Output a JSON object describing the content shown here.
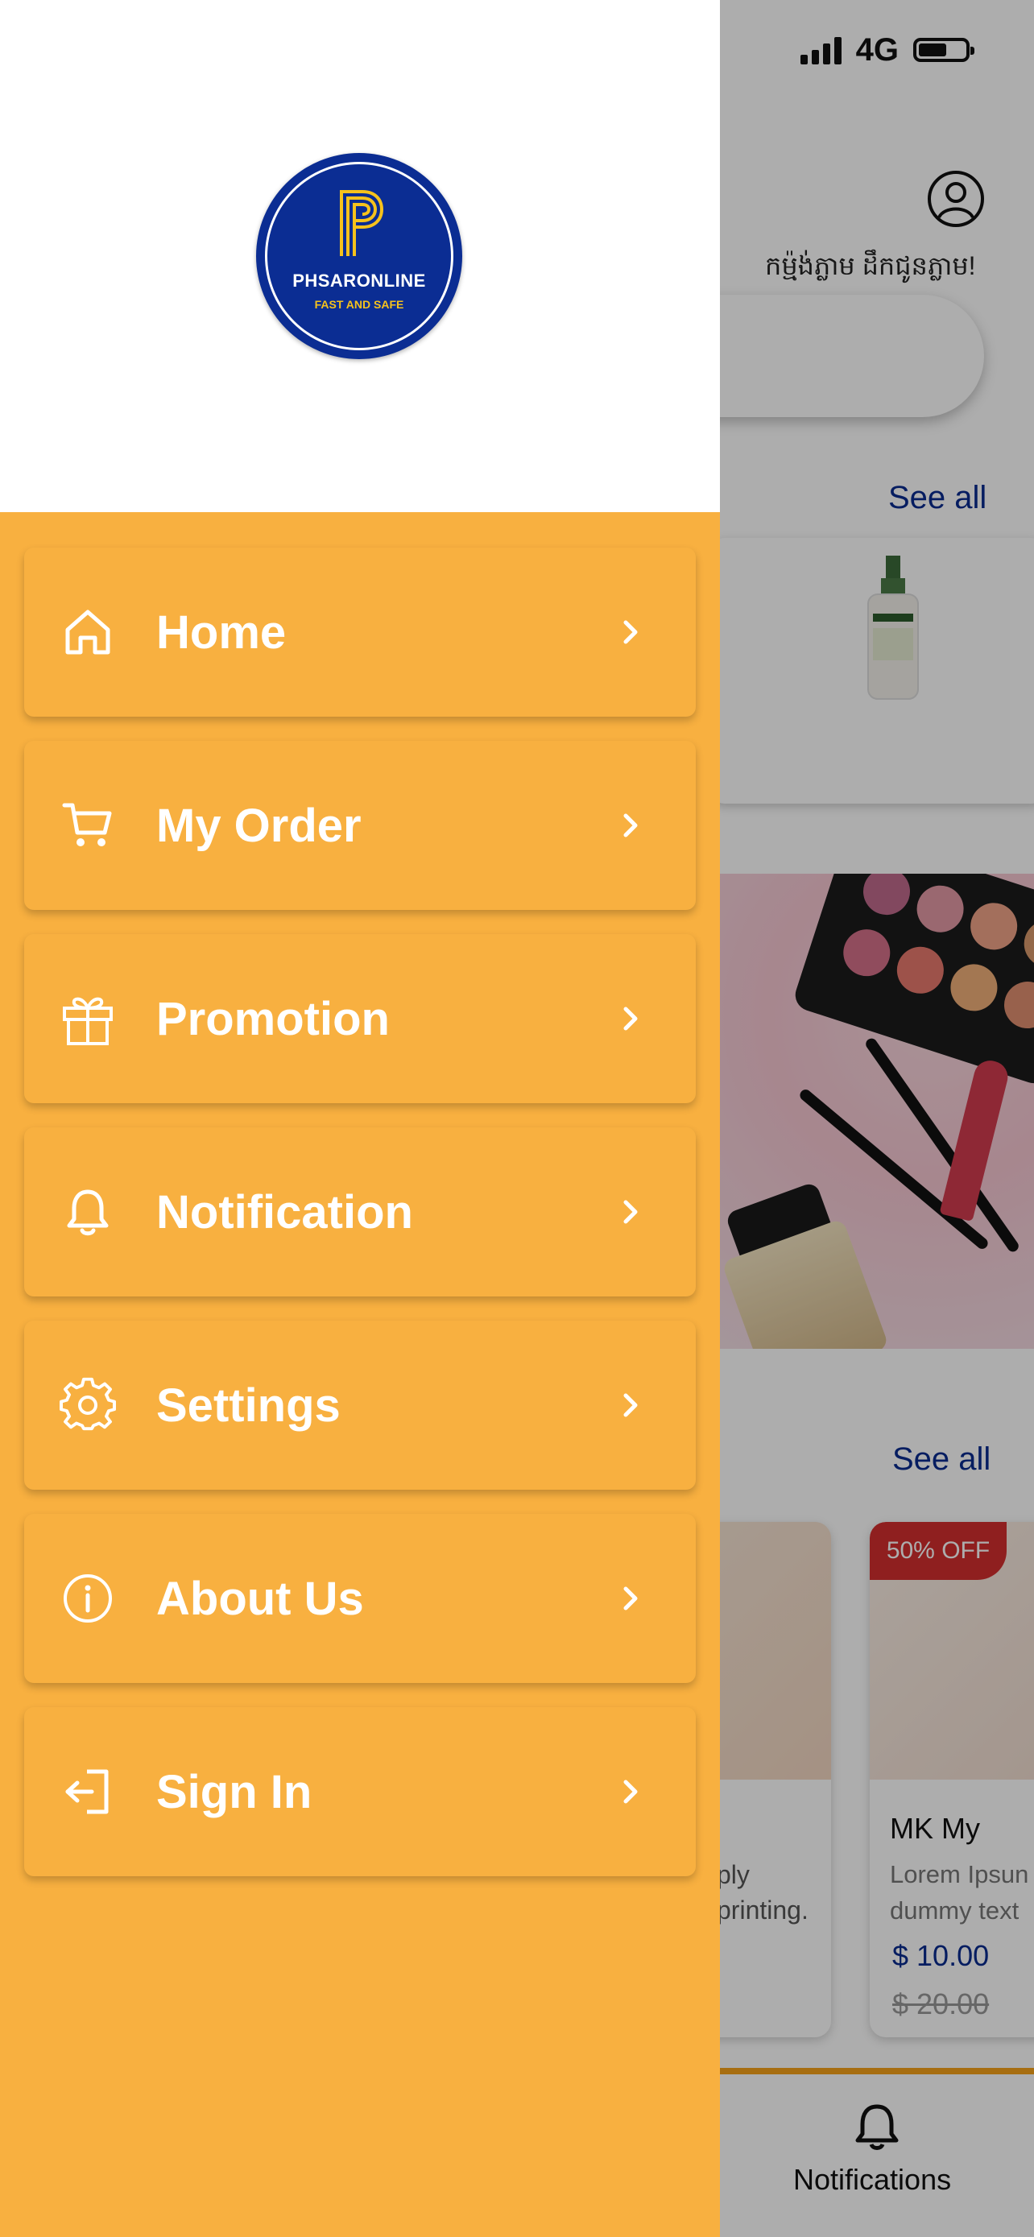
{
  "status_bar": {
    "network": "4G",
    "icons": [
      "signal-icon",
      "battery-icon"
    ]
  },
  "background": {
    "khmer_text": "កម្ម៉ង់ភ្លាម ដឹកជូនភ្លាម!",
    "see_all_1": "See all",
    "see_all_2": "See all",
    "product_card_a": {
      "text_line_1": "ply",
      "text_line_2": "printing."
    },
    "product_card_b": {
      "badge": "50% OFF",
      "name": "MK My",
      "desc_line_1": "Lorem Ipsun",
      "desc_line_2": "dummy text",
      "price": "$ 10.00",
      "old_price": "$ 20.00"
    },
    "bottom_nav": {
      "label": "Notifications",
      "icon": "bell-icon"
    }
  },
  "drawer": {
    "logo": {
      "title": "PHSARONLINE",
      "tagline": "FAST AND SAFE"
    },
    "items": [
      {
        "label": "Home",
        "icon": "home-icon"
      },
      {
        "label": "My Order",
        "icon": "cart-icon"
      },
      {
        "label": "Promotion",
        "icon": "gift-icon"
      },
      {
        "label": "Notification",
        "icon": "bell-icon"
      },
      {
        "label": "Settings",
        "icon": "gear-icon"
      },
      {
        "label": "About Us",
        "icon": "info-icon"
      },
      {
        "label": "Sign In",
        "icon": "sign-in-icon"
      }
    ]
  },
  "colors": {
    "drawer_bg": "#f8b040",
    "brand_blue": "#0b2d93",
    "accent_link": "#0a2c8f",
    "badge_red": "#d32f2f"
  }
}
